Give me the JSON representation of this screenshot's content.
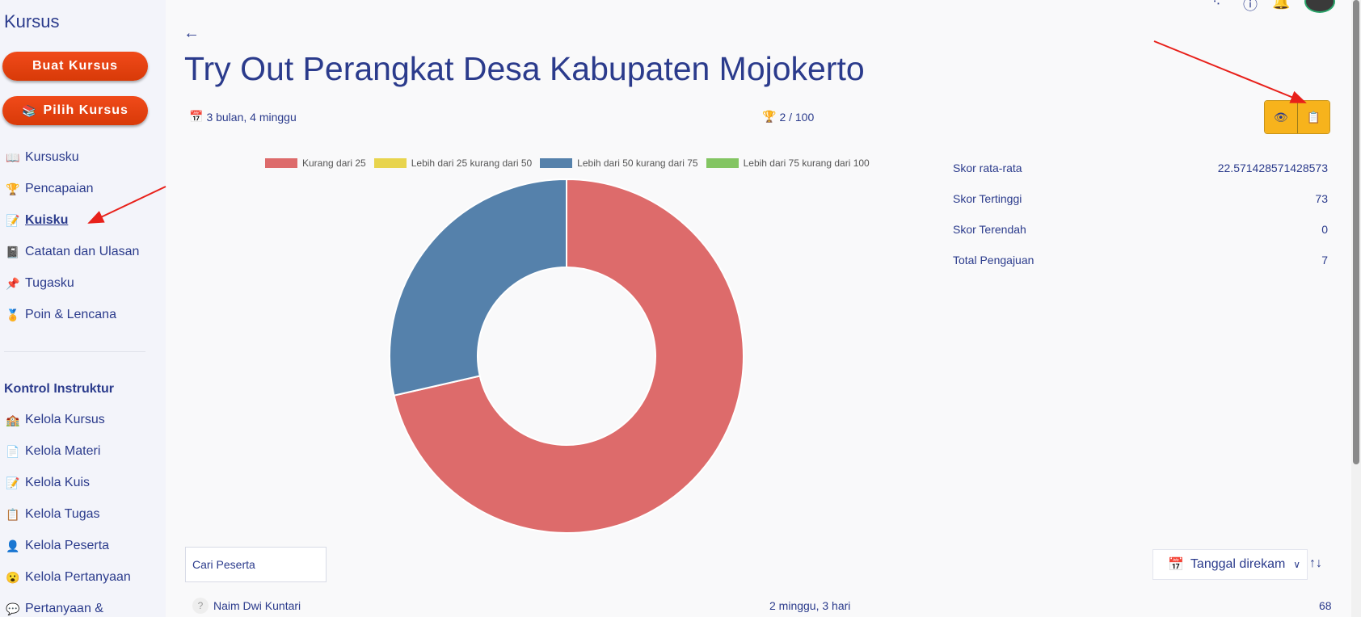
{
  "sidebar": {
    "title": "Kursus",
    "create_button": "Buat Kursus",
    "pick_button": "Pilih Kursus",
    "items": [
      {
        "icon": "📖",
        "label": "Kursusku"
      },
      {
        "icon": "🏆",
        "label": "Pencapaian"
      },
      {
        "icon": "📝",
        "label": " Kuisku"
      },
      {
        "icon": "📓",
        "label": "Catatan dan Ulasan"
      },
      {
        "icon": "📌",
        "label": "Tugasku"
      },
      {
        "icon": "🏅",
        "label": "Poin & Lencana"
      }
    ],
    "section_title": "Kontrol Instruktur",
    "instructor_items": [
      {
        "icon": "🏫",
        "label": "Kelola Kursus"
      },
      {
        "icon": "📄",
        "label": "Kelola Materi"
      },
      {
        "icon": "📝",
        "label": "Kelola Kuis"
      },
      {
        "icon": "📋",
        "label": "Kelola Tugas"
      },
      {
        "icon": "👤",
        "label": "Kelola Peserta"
      },
      {
        "icon": "😮",
        "label": "Kelola Pertanyaan"
      },
      {
        "icon": "💬",
        "label": "Pertanyaan &"
      }
    ]
  },
  "main": {
    "title": "Try Out Perangkat Desa Kabupaten Mojokerto",
    "duration": "3 bulan, 4 minggu",
    "score": "2 / 100"
  },
  "stats": [
    {
      "label": "Skor rata-rata",
      "value": "22.571428571428573"
    },
    {
      "label": "Skor Tertinggi",
      "value": "73"
    },
    {
      "label": "Skor Terendah",
      "value": "0"
    },
    {
      "label": "Total Pengajuan",
      "value": "7"
    }
  ],
  "chart_data": {
    "type": "pie",
    "categories": [
      "Kurang dari 25",
      "Lebih dari 25 kurang dari 50",
      "Lebih dari 50 kurang dari 75",
      "Lebih dari 75 kurang dari 100"
    ],
    "values": [
      5,
      0,
      2,
      0
    ],
    "colors": [
      "#dd6b6b",
      "#e8d44d",
      "#5581ab",
      "#83c562"
    ]
  },
  "controls": {
    "search_placeholder": "Cari Peserta",
    "sort_label": "Tanggal direkam"
  },
  "rows": [
    {
      "name": "Naim Dwi Kuntari",
      "duration": "2 minggu, 3 hari",
      "score": "68"
    }
  ]
}
